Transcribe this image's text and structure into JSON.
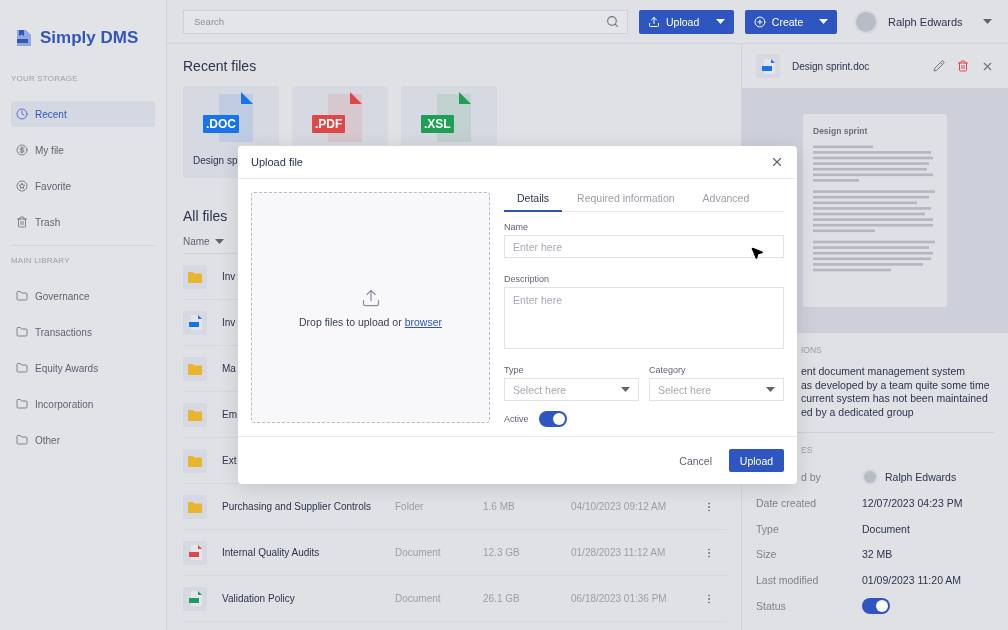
{
  "app": {
    "name": "Simply DMS"
  },
  "sidebar": {
    "sections": [
      {
        "title": "YOUR STORAGE",
        "items": [
          {
            "label": "Recent",
            "selected": true
          },
          {
            "label": "My file",
            "selected": false
          },
          {
            "label": "Favorite",
            "selected": false
          },
          {
            "label": "Trash",
            "selected": false
          }
        ]
      },
      {
        "title": "MAIN LIBRARY",
        "items": [
          {
            "label": "Governance",
            "selected": false
          },
          {
            "label": "Transactions",
            "selected": false
          },
          {
            "label": "Equity Awards",
            "selected": false
          },
          {
            "label": "Incorporation",
            "selected": false
          },
          {
            "label": "Other",
            "selected": false
          }
        ]
      }
    ]
  },
  "topbar": {
    "search": {
      "placeholder": "Search"
    },
    "upload_button": {
      "label": "Upload"
    },
    "create_button": {
      "label": "Create"
    },
    "user": {
      "name": "Ralph Edwards"
    }
  },
  "recent_files": {
    "title": "Recent files",
    "files": [
      {
        "kind": "doc",
        "ext": ".DOC",
        "name": "Design sp"
      },
      {
        "kind": "pdf",
        "ext": ".PDF"
      },
      {
        "kind": "xsl",
        "ext": ".XSL"
      }
    ]
  },
  "all_files": {
    "title": "All files",
    "sort_column": "Name",
    "rows": [
      {
        "kind": "folder",
        "name": "Inv"
      },
      {
        "kind": "doc",
        "name": "Inv"
      },
      {
        "kind": "folder",
        "name": "Ma"
      },
      {
        "kind": "folder",
        "name": "Em"
      },
      {
        "kind": "folder",
        "name": "Ext"
      },
      {
        "kind": "folder",
        "name": "Purchasing and Supplier Controls",
        "type": "Folder",
        "size": "1.6 MB",
        "modified": "04/10/2023 09:12 AM"
      },
      {
        "kind": "pdf",
        "name": "Internal Quality Audits",
        "type": "Document",
        "size": "12.3 GB",
        "modified": "01/28/2023 11:12 AM"
      },
      {
        "kind": "xsl",
        "name": "Validation Policy",
        "type": "Document",
        "size": "26.1 GB",
        "modified": "06/18/2023 01:36 PM"
      }
    ]
  },
  "details_panel": {
    "file_name": "Design sprint.doc",
    "preview": {
      "title": "Design sprint"
    },
    "description_heading": "IONS",
    "description": "ent document management system\nas developed by a team quite some time\ncurrent system has not been maintained\ned by a dedicated group",
    "properties_heading": "ES",
    "properties": [
      {
        "kind": "user",
        "label": "d by",
        "value": "Ralph Edwards"
      },
      {
        "kind": "text",
        "label": "Date created",
        "value": "12/07/2023 04:23 PM"
      },
      {
        "kind": "text",
        "label": "Type",
        "value": "Document"
      },
      {
        "kind": "text",
        "label": "Size",
        "value": "32 MB"
      },
      {
        "kind": "text",
        "label": "Last modified",
        "value": "01/09/2023 11:20 AM"
      },
      {
        "kind": "toggle",
        "label": "Status",
        "on": true
      }
    ]
  },
  "upload_dialog": {
    "title": "Upload file",
    "drop_text": "Drop files to upload or ",
    "drop_link": "browser",
    "tabs": [
      {
        "label": "Details",
        "selected": true
      },
      {
        "label": "Required information",
        "selected": false
      },
      {
        "label": "Advanced",
        "selected": false
      }
    ],
    "fields": [
      {
        "kind": "text",
        "label": "Name",
        "placeholder": "Enter here"
      },
      {
        "kind": "textarea",
        "label": "Description",
        "placeholder": "Enter here"
      }
    ],
    "selects": [
      {
        "label": "Type",
        "placeholder": "Select here"
      },
      {
        "label": "Category",
        "placeholder": "Select here"
      }
    ],
    "active": {
      "label": "Active",
      "on": true
    },
    "cancel_button": "Cancel",
    "submit_button": "Upload"
  }
}
